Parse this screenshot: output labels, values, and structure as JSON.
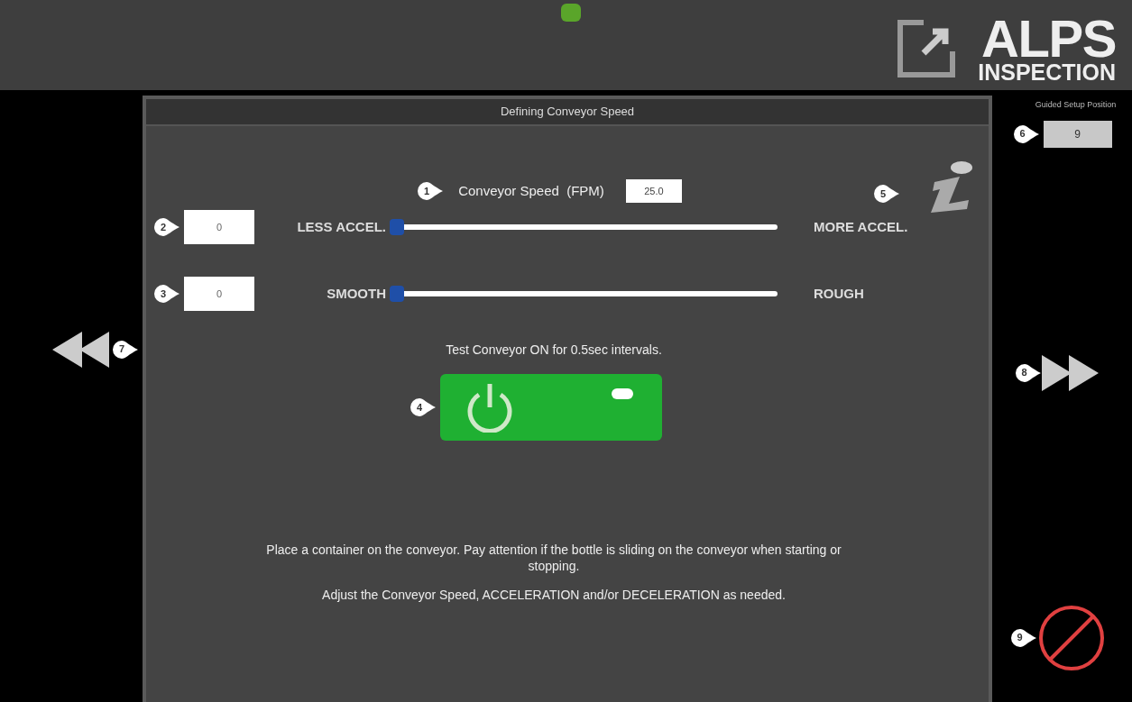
{
  "header": {
    "logo_top": "ALPS",
    "logo_bottom": "INSPECTION"
  },
  "panel": {
    "title": "Defining Conveyor Speed"
  },
  "speed": {
    "callout": "1",
    "label": "Conveyor Speed  (FPM)",
    "value": "25.0"
  },
  "sliders": [
    {
      "callout": "2",
      "value": "0",
      "left_label": "LESS ACCEL.",
      "right_label": "MORE ACCEL.",
      "level": 0
    },
    {
      "callout": "3",
      "value": "0",
      "left_label": "SMOOTH",
      "right_label": "ROUGH",
      "level": 0
    }
  ],
  "test": {
    "text": "Test Conveyor ON for 0.5sec intervals.",
    "callout": "4"
  },
  "info": {
    "callout": "5"
  },
  "position": {
    "label": "Guided Setup Position",
    "callout": "6",
    "value": "9"
  },
  "nav": {
    "back_callout": "7",
    "next_callout": "8",
    "cancel_callout": "9"
  },
  "instructions": [
    "Place a container on the conveyor.   Pay attention if the bottle is sliding on the conveyor when starting or stopping.",
    "Adjust the Conveyor Speed, ACCELERATION and/or DECELERATION as needed."
  ]
}
